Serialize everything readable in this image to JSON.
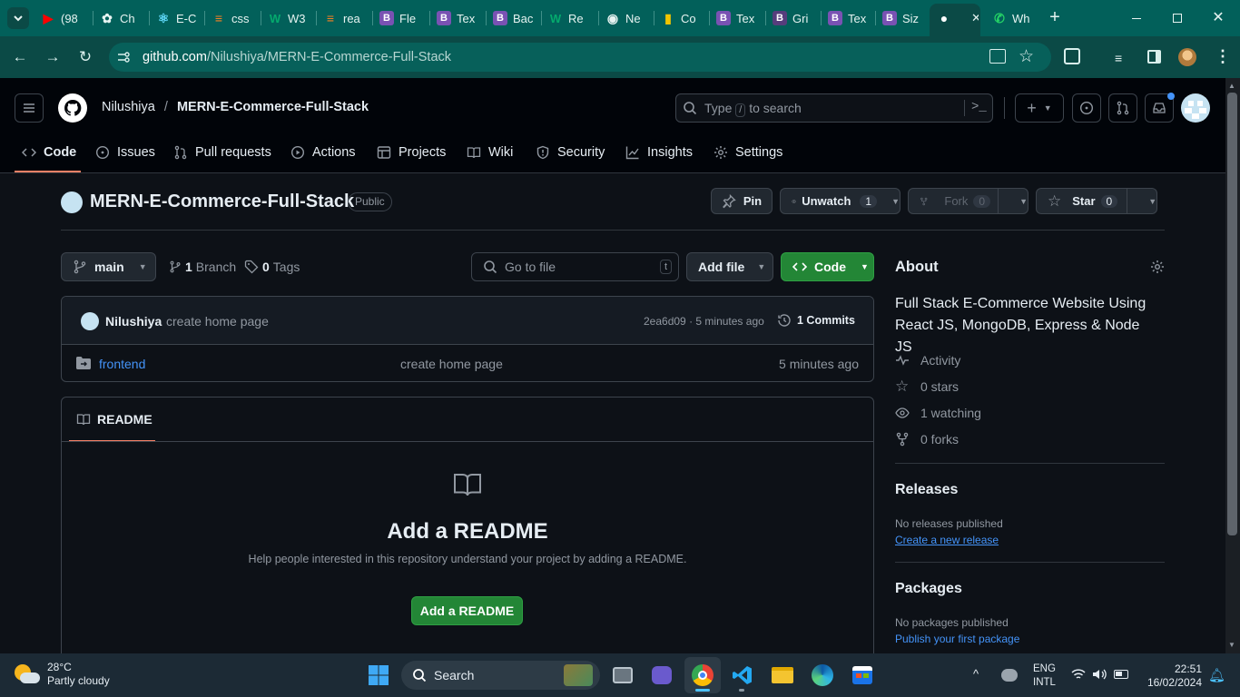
{
  "browser": {
    "tabs": [
      {
        "title": "(98",
        "icon": "youtube-icon",
        "color": "#ff0000"
      },
      {
        "title": "Ch",
        "icon": "chatgpt-icon",
        "color": "#e6f3f1"
      },
      {
        "title": "E-C",
        "icon": "react-icon",
        "color": "#61dafb"
      },
      {
        "title": "css",
        "icon": "stackoverflow-icon",
        "color": "#f48024"
      },
      {
        "title": "W3",
        "icon": "w3schools-icon",
        "color": "#04aa6d"
      },
      {
        "title": "rea",
        "icon": "stackoverflow-icon",
        "color": "#f48024"
      },
      {
        "title": "Fle",
        "icon": "bootstrap-icon",
        "color": "#7952b3"
      },
      {
        "title": "Tex",
        "icon": "bootstrap-icon",
        "color": "#7952b3"
      },
      {
        "title": "Bac",
        "icon": "bootstrap-icon",
        "color": "#7952b3"
      },
      {
        "title": "Re",
        "icon": "w3schools-icon",
        "color": "#04aa6d"
      },
      {
        "title": "Ne",
        "icon": "chrome-icon",
        "color": "#e6f3f1"
      },
      {
        "title": "Co",
        "icon": "belgium-flag-icon",
        "color": "#f2c500"
      },
      {
        "title": "Tex",
        "icon": "bootstrap-icon",
        "color": "#7952b3"
      },
      {
        "title": "Gri",
        "icon": "bootstrap-b-icon",
        "color": "#563d7c"
      },
      {
        "title": "Tex",
        "icon": "bootstrap-icon",
        "color": "#7952b3"
      },
      {
        "title": "Siz",
        "icon": "bootstrap-icon",
        "color": "#7952b3"
      },
      {
        "title": "",
        "icon": "github-icon",
        "color": "#ffffff"
      },
      {
        "title": "Wh",
        "icon": "whatsapp-icon",
        "color": "#25d366"
      }
    ],
    "url_domain": "github.com",
    "url_path": "/Nilushiya/MERN-E-Commerce-Full-Stack"
  },
  "header": {
    "owner": "Nilushiya",
    "separator": "/",
    "repo": "MERN-E-Commerce-Full-Stack",
    "search_prefix": "Type",
    "search_key": "/",
    "search_suffix": "to search"
  },
  "nav": {
    "code": "Code",
    "issues": "Issues",
    "pulls": "Pull requests",
    "actions": "Actions",
    "projects": "Projects",
    "wiki": "Wiki",
    "security": "Security",
    "insights": "Insights",
    "settings": "Settings"
  },
  "repo": {
    "name": "MERN-E-Commerce-Full-Stack",
    "visibility": "Public",
    "pin": "Pin",
    "unwatch": "Unwatch",
    "watch_count": "1",
    "fork": "Fork",
    "fork_count": "0",
    "star": "Star",
    "star_count": "0"
  },
  "filebar": {
    "branch": "main",
    "branch_count": "1",
    "branch_label": "Branch",
    "tag_count": "0",
    "tag_label": "Tags",
    "goto_placeholder": "Go to file",
    "goto_key": "t",
    "add_file": "Add file",
    "code_btn": "Code"
  },
  "commit": {
    "author": "Nilushiya",
    "message": "create home page",
    "sha": "2ea6d09",
    "sep": "·",
    "time": "5 minutes ago",
    "count": "1 Commits"
  },
  "files": [
    {
      "name": "frontend",
      "message": "create home page",
      "time": "5 minutes ago"
    }
  ],
  "readme": {
    "tab": "README",
    "title": "Add a README",
    "desc": "Help people interested in this repository understand your project by adding a README.",
    "button": "Add a README"
  },
  "about": {
    "title": "About",
    "description": "Full Stack E-Commerce Website Using React JS, MongoDB, Express & Node JS",
    "activity": "Activity",
    "stars": "0 stars",
    "watching": "1 watching",
    "forks": "0 forks",
    "releases_title": "Releases",
    "releases_none": "No releases published",
    "releases_link": "Create a new release",
    "packages_title": "Packages",
    "packages_none": "No packages published",
    "packages_link": "Publish your first package"
  },
  "taskbar": {
    "temp": "28°C",
    "weather": "Partly cloudy",
    "search": "Search",
    "lang1": "ENG",
    "lang2": "INTL",
    "time": "22:51",
    "date": "16/02/2024"
  },
  "colors": {
    "accent_green": "#238636",
    "link_blue": "#4493f8",
    "tab_underline": "#f78166",
    "chrome_teal": "#02605a"
  }
}
